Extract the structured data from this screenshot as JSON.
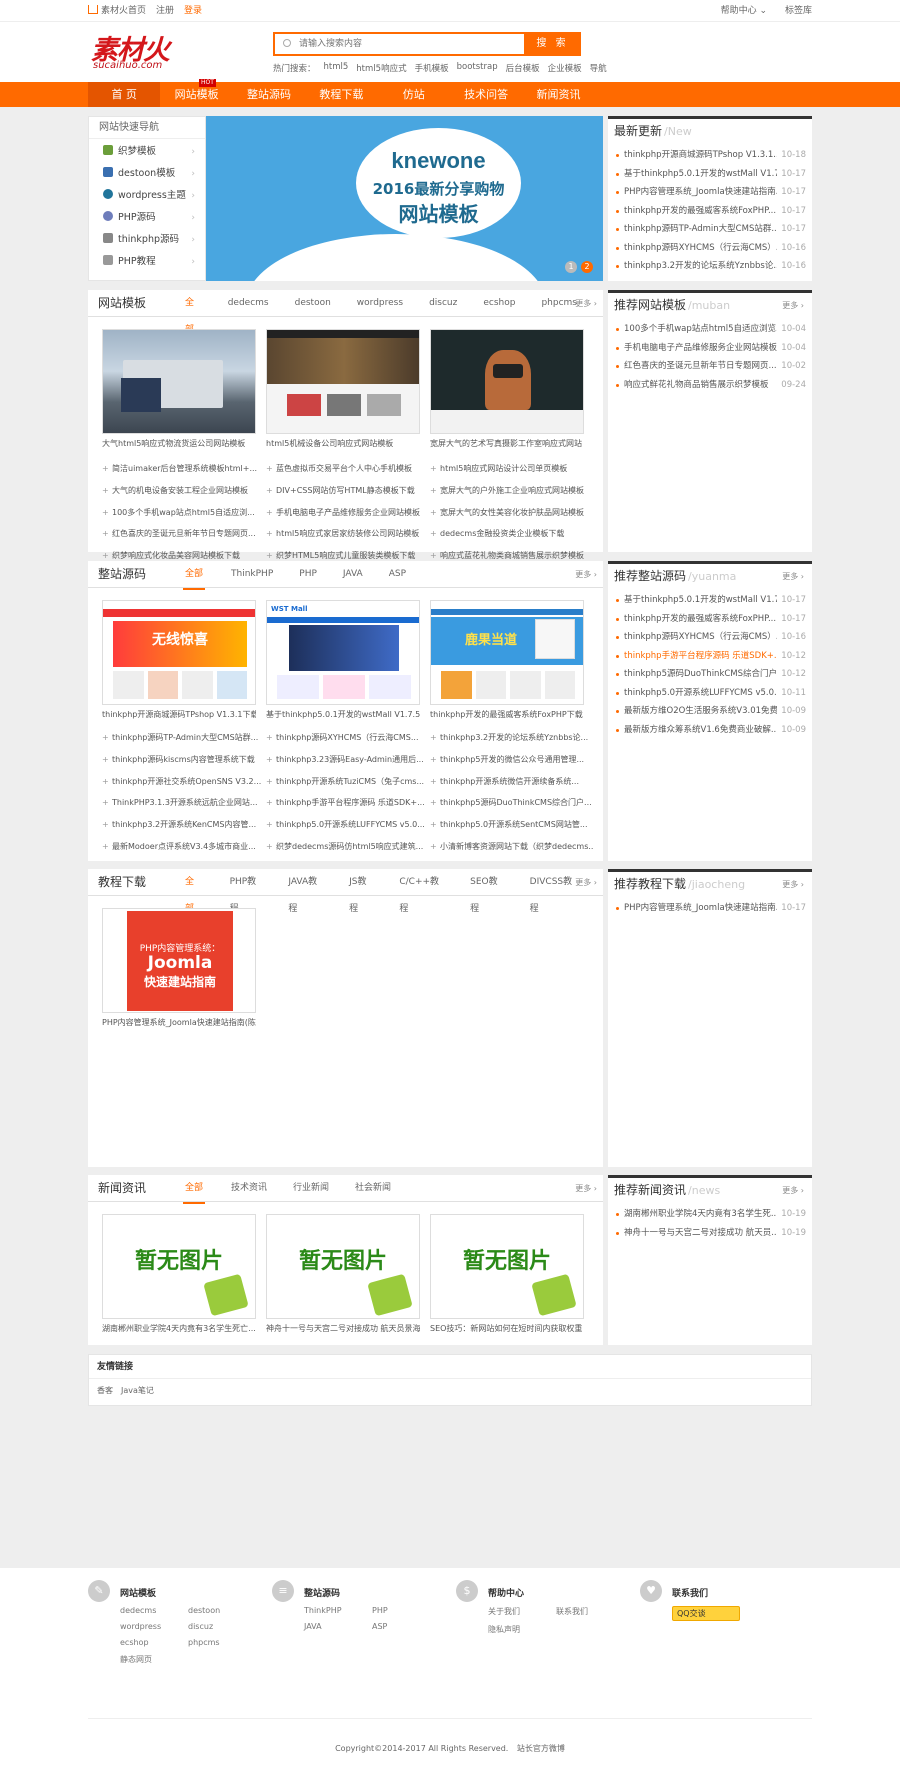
{
  "topbar": {
    "home": "素材火首页",
    "register": "注册",
    "login": "登录",
    "help": "帮助中心",
    "bookmark": "标签库"
  },
  "header": {
    "logo_cn": "素材火",
    "logo_en": "sucaihuo.com",
    "search_placeholder": "请输入搜索内容",
    "search_button": "搜 索",
    "hot_label": "热门搜索：",
    "hot_words": [
      "html5",
      "html5响应式",
      "手机模板",
      "bootstrap",
      "后台模板",
      "企业模板",
      "导航"
    ]
  },
  "nav": {
    "items": [
      "首 页",
      "网站模板",
      "整站源码",
      "教程下载",
      "仿站",
      "技术问答",
      "新闻资讯"
    ],
    "hot_badge": "HOT"
  },
  "quicknav": {
    "title": "网站快速导航",
    "items": [
      "织梦模板",
      "destoon模板",
      "wordpress主题",
      "PHP源码",
      "thinkphp源码",
      "PHP教程"
    ]
  },
  "banner": {
    "line1": "knewone",
    "line2": "2016最新分享购物",
    "line3": "网站模板",
    "pages": [
      "1",
      "2"
    ]
  },
  "latest": {
    "title": "最新更新",
    "en": "/New",
    "items": [
      {
        "t": "thinkphp开源商城源码TPshop V1.3.1...",
        "d": "10-18"
      },
      {
        "t": "基于thinkphp5.0.1开发的wstMall V1.7...",
        "d": "10-17"
      },
      {
        "t": "PHP内容管理系统_Joomla快速建站指南...",
        "d": "10-17"
      },
      {
        "t": "thinkphp开发的最强威客系统FoxPHP...",
        "d": "10-17"
      },
      {
        "t": "thinkphp源码TP-Admin大型CMS站群...",
        "d": "10-17"
      },
      {
        "t": "thinkphp源码XYHCMS（行云海CMS）...",
        "d": "10-16"
      },
      {
        "t": "thinkphp3.2开发的论坛系统Yznbbs论...",
        "d": "10-16"
      }
    ]
  },
  "templates": {
    "title": "网站模板",
    "tabs": [
      "全部",
      "dedecms",
      "destoon",
      "wordpress",
      "discuz",
      "ecshop",
      "phpcms"
    ],
    "more": "更多",
    "thumbs": [
      "大气html5响应式物流货运公司网站模板",
      "html5机械设备公司响应式网站模板",
      "宽屏大气的艺术写真摄影工作室响应式网站"
    ],
    "list": [
      "简洁uimaker后台管理系统模板html+...",
      "蓝色虚拟币交易平台个人中心手机模板",
      "html5响应式网站设计公司单页模板",
      "大气的机电设备安装工程企业网站模板",
      "DIV+CSS网站仿写HTML静态模板下载",
      "宽屏大气的户外施工企业响应式网站模板",
      "100多个手机wap站点html5自适应浏...",
      "手机电脑电子产品维修服务企业网站模板",
      "宽屏大气的女性美容化妆护肤品网站模板",
      "红色喜庆的圣诞元旦新年节日专题网页...",
      "html5响应式家居家纺装修公司网站模板",
      "dedecms金融投资类企业模板下载",
      "织梦响应式化妆品美容网站模板下载",
      "织梦HTML5响应式儿童服装类模板下载",
      "响应式蓝花礼物类商城销售展示织梦模板"
    ]
  },
  "recTemplates": {
    "title": "推荐网站模板",
    "en": "/muban",
    "more": "更多",
    "items": [
      {
        "t": "100多个手机wap站点html5自适应浏览...",
        "d": "10-04"
      },
      {
        "t": "手机电脑电子产品维修服务企业网站模板",
        "d": "10-04"
      },
      {
        "t": "红色喜庆的圣诞元旦新年节日专题网页...",
        "d": "10-02"
      },
      {
        "t": "响应式鲜花礼物商品销售展示织梦模板",
        "d": "09-24"
      }
    ]
  },
  "source": {
    "title": "整站源码",
    "tabs": [
      "全部",
      "ThinkPHP",
      "PHP",
      "JAVA",
      "ASP"
    ],
    "more": "更多",
    "thumbs": [
      "thinkphp开源商城源码TPshop V1.3.1下载",
      "基于thinkphp5.0.1开发的wstMall V1.7.5多",
      "thinkphp开发的最强威客系统FoxPHP下载"
    ],
    "thumb_texts": [
      "无线惊喜",
      "WST Mall",
      "鹿果当道"
    ],
    "list": [
      "thinkphp源码TP-Admin大型CMS站群...",
      "thinkphp源码XYHCMS（行云海CMS...",
      "thinkphp3.2开发的论坛系统Yznbbs论...",
      "thinkphp源码kiscms内容管理系统下载",
      "thinkphp3.23源码Easy-Admin通用后...",
      "thinkphp5开发的微信公众号通用管理...",
      "thinkphp开源社交系统OpenSNS V3.2...",
      "thinkphp开源系统TuziCMS（兔子cms...",
      "thinkphp开源系统微信开源续备系统...",
      "ThinkPHP3.1.3开源系统远航企业网站...",
      "thinkphp手游平台程序源码 乐道SDK+...",
      "thinkphp5源码DuoThinkCMS综合门户...",
      "thinkphp3.2开源系统KenCMS内容管...",
      "thinkphp5.0开源系统LUFFYCMS v5.0...",
      "thinkphp5.0开源系统SentCMS网站管...",
      "最新Modoer点评系统V3.4多城市商业...",
      "织梦dedecms源码仿html5响应式建筑...",
      "小清新博客资源网站下载（织梦dedecms..."
    ]
  },
  "recSource": {
    "title": "推荐整站源码",
    "en": "/yuanma",
    "more": "更多",
    "items": [
      {
        "t": "基于thinkphp5.0.1开发的wstMall V1.7...",
        "d": "10-17"
      },
      {
        "t": "thinkphp开发的最强威客系统FoxPHP...",
        "d": "10-17"
      },
      {
        "t": "thinkphp源码XYHCMS（行云海CMS）...",
        "d": "10-16"
      },
      {
        "t": "thinkphp手游平台程序源码 乐道SDK+...",
        "d": "10-12",
        "hl": true
      },
      {
        "t": "thinkphp5源码DuoThinkCMS综合门户...",
        "d": "10-12"
      },
      {
        "t": "thinkphp5.0开源系统LUFFYCMS v5.0...",
        "d": "10-11"
      },
      {
        "t": "最新版方维O2O生活服务系统V3.01免费...",
        "d": "10-09"
      },
      {
        "t": "最新版方维众筹系统V1.6免费商业破解...",
        "d": "10-09"
      }
    ]
  },
  "tutorials": {
    "title": "教程下载",
    "tabs": [
      "全部",
      "PHP教程",
      "JAVA教程",
      "JS教程",
      "C/C++教程",
      "SEO教程",
      "DIVCSS教程"
    ],
    "more": "更多",
    "book_line1": "PHP内容管理系统：",
    "book_line2": "Joomla",
    "book_line3": "快速建站指南",
    "thumbs": [
      "PHP内容管理系统_Joomla快速建站指南(陈"
    ]
  },
  "recTutorials": {
    "title": "推荐教程下载",
    "en": "/jiaocheng",
    "more": "更多",
    "items": [
      {
        "t": "PHP内容管理系统_Joomla快速建站指南...",
        "d": "10-17"
      }
    ]
  },
  "news": {
    "title": "新闻资讯",
    "tabs": [
      "全部",
      "技术资讯",
      "行业新闻",
      "社会新闻"
    ],
    "more": "更多",
    "noimg": "暂无图片",
    "thumbs": [
      "湖南郴州职业学院4天内竟有3名学生死亡...",
      "神舟十一号与天宫二号对接成功 航天员景海",
      "SEO技巧：新网站如何在短时间内获取权重"
    ]
  },
  "recNews": {
    "title": "推荐新闻资讯",
    "en": "/news",
    "more": "更多",
    "items": [
      {
        "t": "湖南郴州职业学院4天内竟有3名学生死...",
        "d": "10-19"
      },
      {
        "t": "神舟十一号与天宫二号对接成功 航天员...",
        "d": "10-19"
      }
    ]
  },
  "links": {
    "title": "友情链接",
    "items": [
      "香客",
      "Java笔记"
    ]
  },
  "footer": {
    "cols": [
      {
        "title": "网站模板",
        "items": [
          "dedecms",
          "destoon",
          "wordpress",
          "discuz",
          "ecshop",
          "phpcms",
          "静态网页"
        ]
      },
      {
        "title": "整站源码",
        "items": [
          "ThinkPHP",
          "PHP",
          "JAVA",
          "ASP"
        ]
      },
      {
        "title": "帮助中心",
        "items": [
          "关于我们",
          "联系我们",
          "隐私声明"
        ]
      },
      {
        "title": "联系我们",
        "items": []
      }
    ],
    "qq": "QQ交谈",
    "copyright": "Copyright©2014-2017 All Rights Reserved.",
    "site_link": "站长官方微博"
  },
  "colors": {
    "accent": "#ff6a00",
    "nav_active": "#e45500",
    "banner_bg": "#49a6e0",
    "page_bg": "#eeeeee"
  }
}
